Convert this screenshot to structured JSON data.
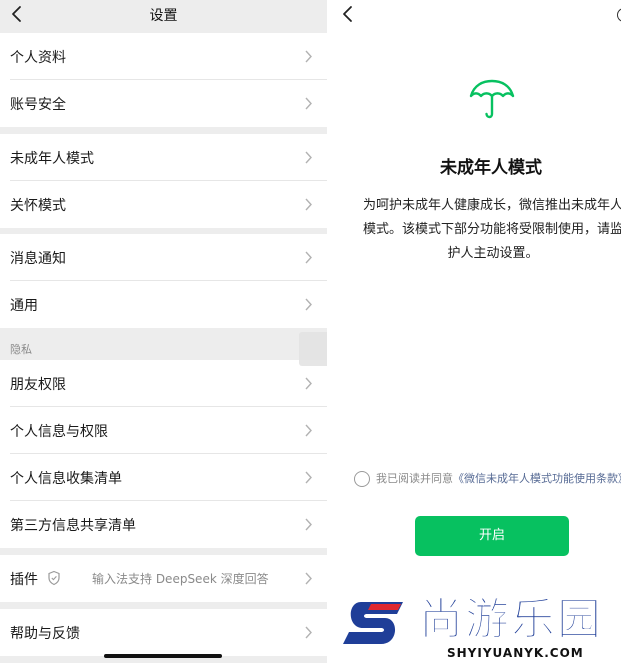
{
  "settings": {
    "title": "设置",
    "rows": {
      "profile": "个人资料",
      "account_security": "账号安全",
      "minor_mode": "未成年人模式",
      "care_mode": "关怀模式",
      "notifications": "消息通知",
      "general": "通用",
      "friend_permissions": "朋友权限",
      "personal_info_permissions": "个人信息与权限",
      "personal_info_collection": "个人信息收集清单",
      "third_party_sharing": "第三方信息共享清单",
      "plugins": "插件",
      "help_feedback": "帮助与反馈"
    },
    "privacy_section": "隐私",
    "plugins_hint": "输入法支持 DeepSeek 深度回答",
    "plugin_icon": "shield-icon"
  },
  "minor_mode_page": {
    "title": "未成年人模式",
    "icon": "umbrella-icon",
    "description": "为呵护未成年人健康成长，微信推出未成年人模式。该模式下部分功能将受限制使用，请监护人主动设置。",
    "agreement_prefix": "我已阅读并同意",
    "agreement_link": "《微信未成年人模式功能使用条款》",
    "open_button": "开启"
  },
  "watermark": {
    "cn": "尚游乐园",
    "en": "SHYIYUANYK.COM"
  },
  "colors": {
    "accent_green": "#07c160",
    "link_blue": "#576b95",
    "watermark_blue": "#1f3e98",
    "watermark_red": "#e0282f",
    "background_gray": "#ededed"
  }
}
